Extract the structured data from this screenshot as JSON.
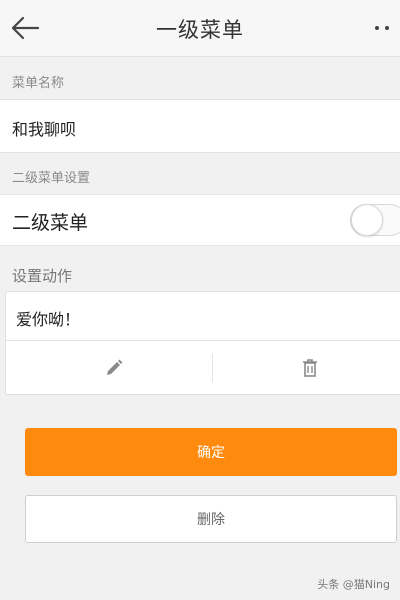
{
  "header": {
    "back_icon": "arrow-left-icon",
    "title": "一级菜单",
    "more_icon": "more-dots-icon"
  },
  "menu_name": {
    "label": "菜单名称",
    "value": "和我聊呗"
  },
  "submenu": {
    "label": "二级菜单设置",
    "row_label": "二级菜单",
    "enabled": false
  },
  "action": {
    "label": "设置动作",
    "value": "爱你呦！",
    "edit_icon": "pencil-icon",
    "delete_icon": "trash-icon"
  },
  "buttons": {
    "confirm_label": "确定",
    "delete_label": "删除"
  },
  "watermark": "头条 @猫Ning",
  "colors": {
    "accent": "#ff8a0d",
    "background": "#f1f1f1"
  }
}
